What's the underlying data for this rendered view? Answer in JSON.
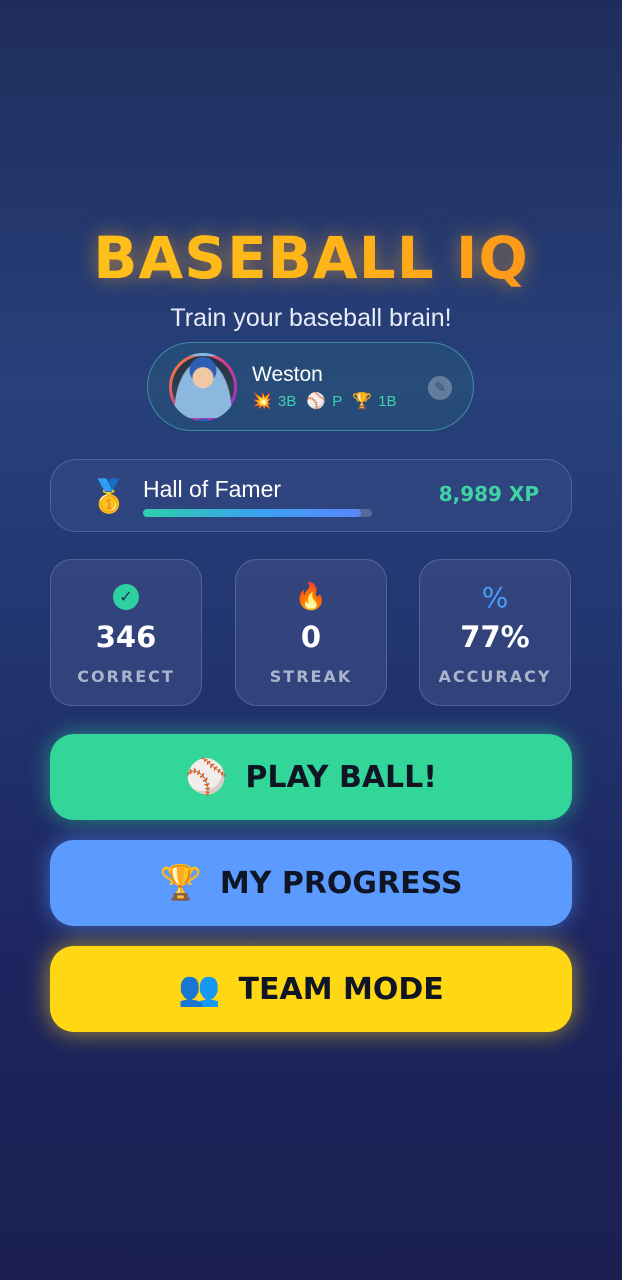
{
  "header": {
    "title": "BASEBALL IQ",
    "subtitle": "Train your baseball brain!"
  },
  "profile": {
    "name": "Weston",
    "badges": [
      {
        "icon": "collision-emoji-icon",
        "glyph": "💥",
        "label": "3B"
      },
      {
        "icon": "baseball-icon",
        "glyph": "⚾",
        "label": "P"
      },
      {
        "icon": "trophy-icon",
        "glyph": "🏆",
        "label": "1B"
      }
    ],
    "edit_icon": "pencil-icon",
    "edit_glyph": "✎"
  },
  "level": {
    "icon": "medal-icon",
    "glyph": "🥇",
    "name": "Hall of Famer",
    "xp": "8,989 XP",
    "progress_fraction": 0.95
  },
  "stats": [
    {
      "icon": "check-circle-icon",
      "glyph": "✓",
      "value": "346",
      "label": "CORRECT",
      "color": "#2fd0a0"
    },
    {
      "icon": "fire-icon",
      "glyph": "🔥",
      "value": "0",
      "label": "STREAK",
      "color": "#ff4d6a"
    },
    {
      "icon": "percent-icon",
      "glyph": "%",
      "value": "77%",
      "label": "ACCURACY",
      "color": "#4c9cff"
    }
  ],
  "actions": [
    {
      "icon": "baseball-icon",
      "glyph": "⚾",
      "label": "PLAY BALL!",
      "color": "#33d699"
    },
    {
      "icon": "trophy-icon",
      "glyph": "🏆",
      "label": "MY PROGRESS",
      "color": "#5b9bff"
    },
    {
      "icon": "people-icon",
      "glyph": "👥",
      "label": "TEAM MODE",
      "color": "#ffd813"
    }
  ],
  "colors": {
    "title_gradient_start": "#ffc51a",
    "title_gradient_end": "#ff8a1a",
    "accent_teal": "#3fd2a2",
    "background": "#223670"
  }
}
